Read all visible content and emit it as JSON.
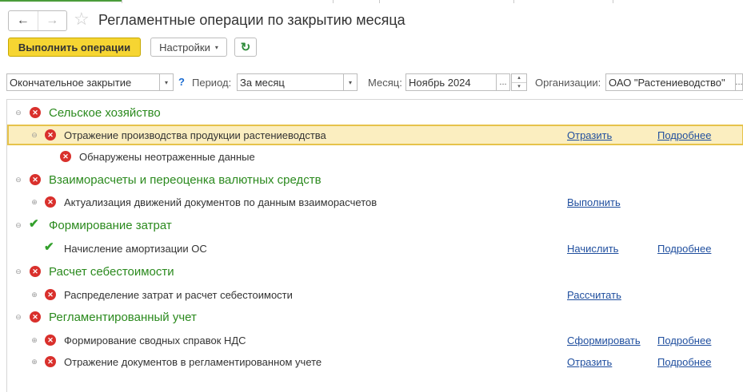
{
  "header": {
    "back_glyph": "←",
    "forward_glyph": "→",
    "favorite_glyph": "☆",
    "title": "Регламентные операции по закрытию месяца"
  },
  "toolbar": {
    "execute_label": "Выполнить операции",
    "settings_label": "Настройки",
    "settings_caret": "▾",
    "refresh_glyph": "↻"
  },
  "filters": {
    "mode_value": "Окончательное закрытие",
    "help_glyph": "?",
    "period_label": "Период:",
    "period_value": "За месяц",
    "month_label": "Месяц:",
    "month_value": "Ноябрь 2024",
    "org_label": "Организации:",
    "org_value": "ОАО \"Растениеводство\"",
    "dropdown_glyph": "▾",
    "dots_glyph": "...",
    "spin_up": "▴",
    "spin_down": "▾"
  },
  "tree": {
    "collapse_glyph": "⊖",
    "expand_glyph": "⊕",
    "error_glyph": "✕",
    "ok_glyph": "✔",
    "groups": [
      {
        "title": "Сельское хозяйство",
        "status": "error"
      },
      {
        "title": "Взаиморасчеты и переоценка валютных средств",
        "status": "error"
      },
      {
        "title": "Формирование затрат",
        "status": "ok"
      },
      {
        "title": "Расчет себестоимости",
        "status": "error"
      },
      {
        "title": "Регламентированный учет",
        "status": "error"
      }
    ],
    "items": [
      {
        "label": "Отражение производства продукции растениеводства",
        "status": "error",
        "action": "Отразить",
        "details": "Подробнее",
        "selected": true
      },
      {
        "label": "Обнаружены неотраженные данные",
        "status": "error"
      },
      {
        "label": "Актуализация движений документов по данным взаиморасчетов",
        "status": "error",
        "action": "Выполнить"
      },
      {
        "label": "Начисление амортизации ОС",
        "status": "ok",
        "action": "Начислить",
        "details": "Подробнее"
      },
      {
        "label": "Распределение затрат и расчет себестоимости",
        "status": "error",
        "action": "Рассчитать"
      },
      {
        "label": "Формирование сводных справок НДС",
        "status": "error",
        "action": "Сформировать",
        "details": "Подробнее"
      },
      {
        "label": "Отражение документов в регламентированном учете",
        "status": "error",
        "action": "Отразить",
        "details": "Подробнее"
      }
    ]
  },
  "colors": {
    "accent_yellow": "#f6d532",
    "group_green": "#2b8a1e",
    "error_red": "#d9302c",
    "ok_green": "#33a02c",
    "link_blue": "#1f4e9e",
    "selected_row": "#fbeec0"
  }
}
